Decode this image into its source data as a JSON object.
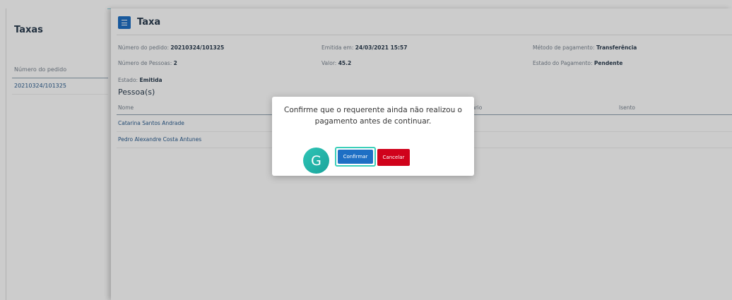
{
  "left_panel": {
    "title": "Taxas",
    "column_header": "Número do pedido",
    "rows": [
      "20210324/101325"
    ]
  },
  "main": {
    "title": "Taxa",
    "info": {
      "order_label": "Número do pedido:",
      "order_value": "20210324/101325",
      "issued_label": "Emitida em:",
      "issued_value": "24/03/2021 15:57",
      "payment_method_label": "Método de pagamento:",
      "payment_method_value": "Transferência",
      "people_label": "Número de Pessoas:",
      "people_value": "2",
      "value_label": "Valor:",
      "value_value": "45.2",
      "payment_state_label": "Estado do Pagamento:",
      "payment_state_value": "Pendente",
      "state_label": "Estado:",
      "state_value": "Emitida"
    },
    "section_title": "Pessoa(s)",
    "table": {
      "headers": [
        "Nome",
        "ário",
        "Isento"
      ],
      "rows": [
        "Catarina Santos Andrade",
        "Pedro Alexandre Costa Antunes"
      ]
    }
  },
  "modal": {
    "message": "Confirme que o requerente ainda não realizou o pagamento antes de continuar.",
    "avatar_letter": "G",
    "confirm_label": "Confirmar",
    "cancel_label": "Cancelar"
  },
  "colors": {
    "primary": "#1e6fc4",
    "danger": "#d0021b",
    "accent": "#3ccfba"
  },
  "icons": {
    "menu": "hamburger-icon"
  }
}
